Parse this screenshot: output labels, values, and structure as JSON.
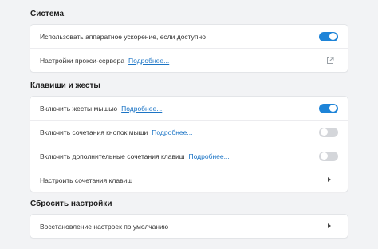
{
  "sections": [
    {
      "title": "Система",
      "rows": [
        {
          "label": "Использовать аппаратное ускорение, если доступно",
          "toggle": "on"
        },
        {
          "label": "Настройки прокси-сервера",
          "more": "Подробнее...",
          "icon": "external-link-icon"
        }
      ]
    },
    {
      "title": "Клавиши и жесты",
      "rows": [
        {
          "label": "Включить жесты мышью",
          "more": "Подробнее...",
          "toggle": "on"
        },
        {
          "label": "Включить сочетания кнопок мыши",
          "more": "Подробнее...",
          "toggle": "off"
        },
        {
          "label": "Включить дополнительные сочетания клавиш",
          "more": "Подробнее...",
          "toggle": "off"
        },
        {
          "label": "Настроить сочетания клавиш",
          "icon": "chevron-right-icon"
        }
      ]
    },
    {
      "title": "Сбросить настройки",
      "rows": [
        {
          "label": "Восстановление настроек по умолчанию",
          "icon": "chevron-right-icon"
        }
      ]
    }
  ],
  "colors": {
    "accent": "#1e84d8",
    "link": "#1b74c5",
    "toggle_off": "#d4d6da",
    "background": "#f2f3f5"
  }
}
